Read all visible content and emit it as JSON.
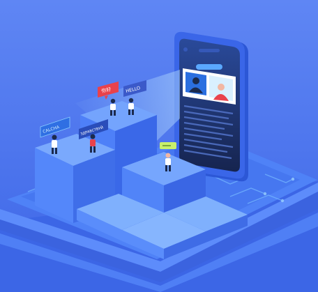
{
  "scene": {
    "palette": {
      "background_top": "#5d83f4",
      "background_bottom": "#3f6ae9",
      "platform": "#4877f2",
      "cube_top": "#73a2fd",
      "cube_left": "#4e7ef8",
      "cube_right": "#3a66e6",
      "phone_body": "#3a64e4",
      "phone_screen": "#1c2f63",
      "accent": "#ffffff"
    },
    "bubbles": [
      {
        "text": "你好",
        "color": "#e9424c"
      },
      {
        "text": "HELLO",
        "color": "#3b59c9"
      },
      {
        "text": "CALCHA",
        "color": "#2f6fe3"
      },
      {
        "text": "ЗДРАВСТВУЙ",
        "color": "#2a4dba"
      },
      {
        "text": "…",
        "color": "#c8f06b"
      }
    ],
    "icons": [
      "video-call-icon",
      "chat-lines-icon",
      "globe-network-icon"
    ]
  }
}
